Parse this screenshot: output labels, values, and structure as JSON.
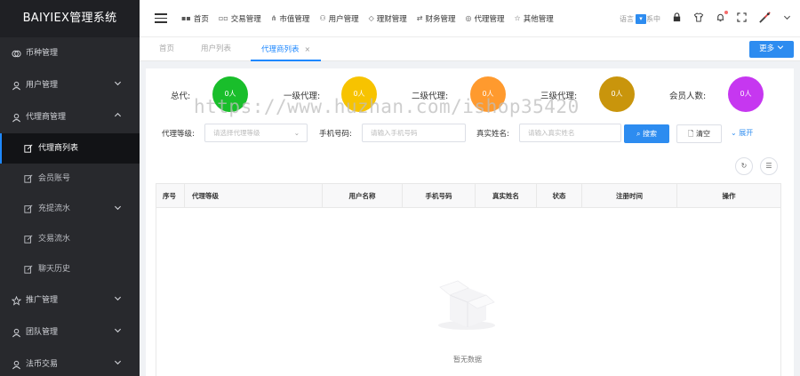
{
  "app": {
    "brand": "BAIYIEX管理系统"
  },
  "sidebar": {
    "items": [
      {
        "label": "币种管理",
        "icon": "coin-icon",
        "expandable": false
      },
      {
        "label": "用户管理",
        "icon": "user-icon",
        "expandable": true
      },
      {
        "label": "代理商管理",
        "icon": "agent-icon",
        "expandable": true,
        "expanded": true,
        "children": [
          {
            "label": "代理商列表",
            "active": true
          },
          {
            "label": "会员账号"
          },
          {
            "label": "充提流水",
            "expandable": true
          },
          {
            "label": "交易流水"
          },
          {
            "label": "聊天历史"
          }
        ]
      },
      {
        "label": "推广管理",
        "icon": "star-icon",
        "expandable": true
      },
      {
        "label": "团队管理",
        "icon": "team-icon",
        "expandable": true
      },
      {
        "label": "法币交易",
        "icon": "user-icon",
        "expandable": true
      }
    ]
  },
  "topnav": {
    "items": [
      {
        "label": "首页",
        "icon": "grid-icon"
      },
      {
        "label": "交易管理",
        "icon": "apps-icon"
      },
      {
        "label": "市值管理",
        "icon": "network-icon"
      },
      {
        "label": "用户管理",
        "icon": "user-icon"
      },
      {
        "label": "理财管理",
        "icon": "diamond-icon"
      },
      {
        "label": "财务管理",
        "icon": "finance-icon"
      },
      {
        "label": "代理管理",
        "icon": "agent-icon"
      },
      {
        "label": "其他管理",
        "icon": "star-icon"
      }
    ],
    "lang_prefix": "语言",
    "lang_suffix": "系中"
  },
  "tabs": [
    {
      "label": "首页"
    },
    {
      "label": "用户列表"
    },
    {
      "label": "代理商列表",
      "active": true,
      "close": "×"
    }
  ],
  "more_button": "更多",
  "stats": [
    {
      "label": "总代:",
      "value": "0人",
      "color": "#19be2b"
    },
    {
      "label": "一级代理:",
      "value": "0人",
      "color": "#f7c300"
    },
    {
      "label": "二级代理:",
      "value": "0人",
      "color": "#ff9a2e"
    },
    {
      "label": "三级代理:",
      "value": "0人",
      "color": "#c9950c"
    },
    {
      "label": "会员人数:",
      "value": "0人",
      "color": "#c637f0"
    }
  ],
  "filters": {
    "level_label": "代理等级:",
    "level_placeholder": "请选择代理等级",
    "phone_label": "手机号码:",
    "phone_placeholder": "请输入手机号码",
    "name_label": "真实姓名:",
    "name_placeholder": "请输入真实姓名",
    "search_button": "搜索",
    "clear_button": "清空",
    "expand_button": "展开"
  },
  "table": {
    "columns": [
      "序号",
      "代理等级",
      "用户名称",
      "手机号码",
      "真实姓名",
      "状态",
      "注册时间",
      "操作"
    ],
    "rows": [],
    "empty_text": "暂无数据"
  },
  "watermark": "https://www.huzhan.com/ishop35420",
  "colors": {
    "primary": "#2d8cf0",
    "sidebar_bg": "#28292d"
  }
}
